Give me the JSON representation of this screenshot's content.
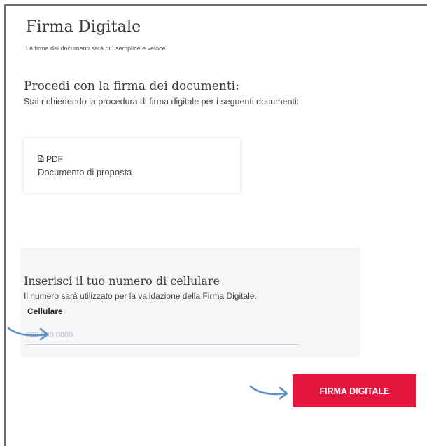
{
  "header": {
    "title": "Firma Digitale",
    "subtitle": "La firma dei documenti sarà più semplice e veloce."
  },
  "documents_section": {
    "title": "Procedi con la firma dei documenti:",
    "description": "Stai richiedendo la procedura di firma digitale per i seguenti documenti:",
    "documents": [
      {
        "type": "PDF",
        "icon": "file-icon",
        "name": "Documento di proposta"
      }
    ]
  },
  "phone_section": {
    "title": "Inserisci il tuo numero di cellulare",
    "description": "Il numero sarà utilizzato per la validazione della Firma Digitale.",
    "field_label": "Cellulare",
    "field_placeholder": "000 000 0000",
    "field_value": ""
  },
  "actions": {
    "sign_label": "FIRMA DIGITALE"
  },
  "colors": {
    "accent": "#e3173e",
    "panel_background": "#f5f6f8",
    "annotation_arrow": "#5a8fc8"
  }
}
